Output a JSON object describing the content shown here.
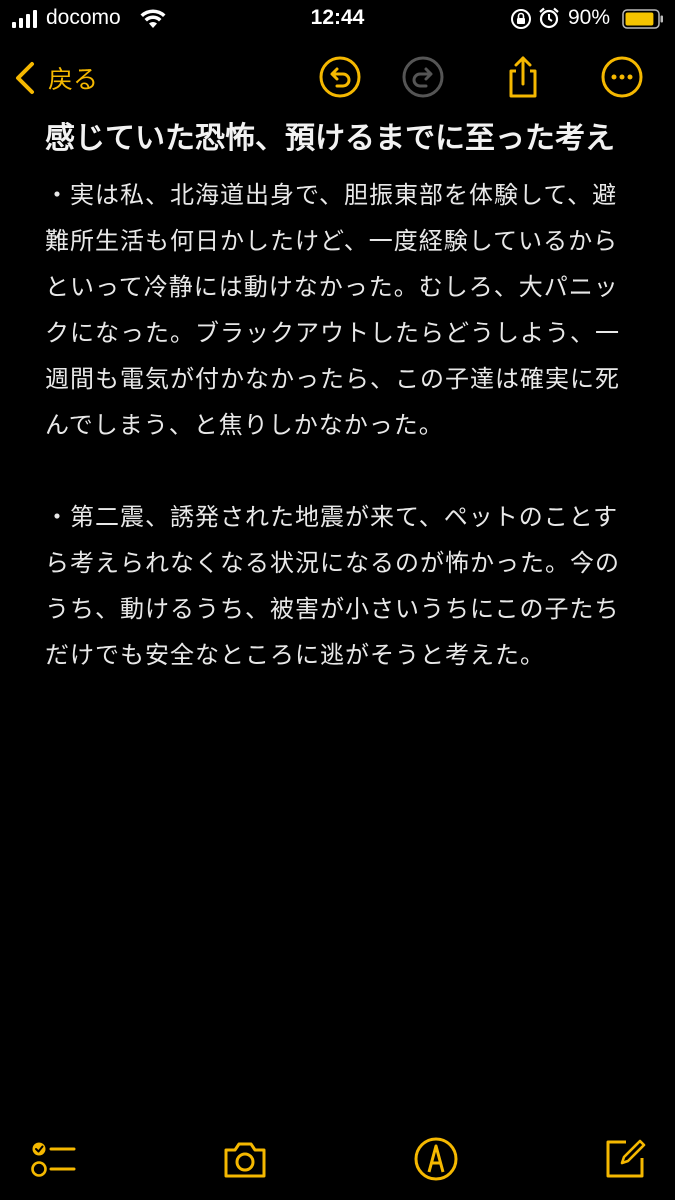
{
  "status_bar": {
    "carrier": "docomo",
    "time": "12:44",
    "battery_percent": "90%",
    "battery_level": 0.9
  },
  "nav": {
    "back_label": "戻る",
    "icons": [
      "undo-icon",
      "redo-icon",
      "share-icon",
      "more-icon"
    ]
  },
  "note": {
    "title": "感じていた恐怖、預けるまでに至った考え",
    "paragraphs": [
      "・実は私、北海道出身で、胆振東部を体験して、避難所生活も何日かしたけど、一度経験しているからといって冷静には動けなかった。むしろ、大パニックになった。ブラックアウトしたらどうしよう、一週間も電気が付かなかったら、この子達は確実に死んでしまう、と焦りしかなかった。",
      "・第二震、誘発された地震が来て、ペットのことすら考えられなくなる状況になるのが怖かった。今のうち、動けるうち、被害が小さいうちにこの子たちだけでも安全なところに逃がそうと考えた。"
    ]
  },
  "toolbar": {
    "icons": [
      "checklist-icon",
      "camera-icon",
      "markup-icon",
      "compose-icon"
    ]
  },
  "colors": {
    "accent": "#f5b800",
    "background": "#000000",
    "text": "#ffffff"
  }
}
